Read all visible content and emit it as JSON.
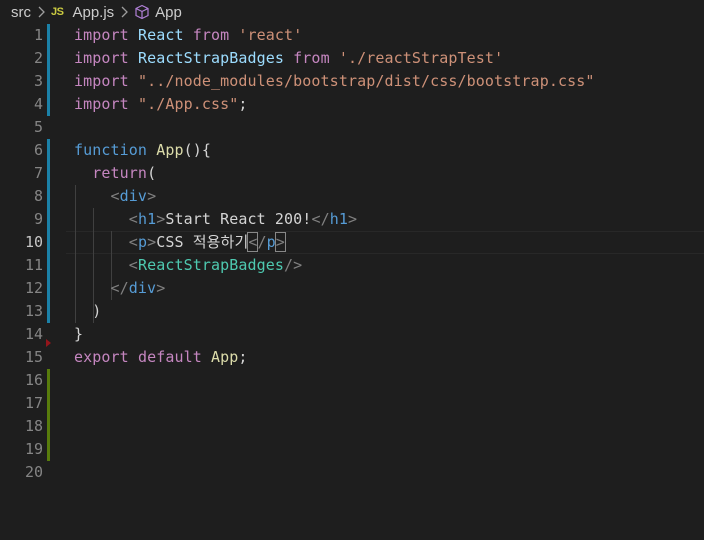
{
  "breadcrumb": {
    "folder": "src",
    "file_badge": "JS",
    "file": "App.js",
    "symbol": "App"
  },
  "active_line": 10,
  "gutter": {
    "modified_lines": [
      1,
      2,
      3,
      4,
      6,
      7,
      8,
      9,
      10,
      11,
      12,
      13
    ],
    "added_lines": [
      16,
      17,
      18,
      19
    ],
    "deleted_after_line": 14
  },
  "lines": [
    {
      "n": "1",
      "tokens": [
        {
          "t": "import",
          "c": "kw2"
        },
        {
          "t": " "
        },
        {
          "t": "React",
          "c": "id"
        },
        {
          "t": " "
        },
        {
          "t": "from",
          "c": "kw2"
        },
        {
          "t": " "
        },
        {
          "t": "'react'",
          "c": "str"
        }
      ]
    },
    {
      "n": "2",
      "tokens": [
        {
          "t": "import",
          "c": "kw2"
        },
        {
          "t": " "
        },
        {
          "t": "ReactStrapBadges",
          "c": "id"
        },
        {
          "t": " "
        },
        {
          "t": "from",
          "c": "kw2"
        },
        {
          "t": " "
        },
        {
          "t": "'./reactStrapTest'",
          "c": "str"
        }
      ]
    },
    {
      "n": "3",
      "tokens": [
        {
          "t": "import",
          "c": "kw2"
        },
        {
          "t": " "
        },
        {
          "t": "\"../node_modules/bootstrap/dist/css/bootstrap.css\"",
          "c": "str"
        }
      ]
    },
    {
      "n": "4",
      "tokens": [
        {
          "t": "import",
          "c": "kw2"
        },
        {
          "t": " "
        },
        {
          "t": "\"./App.css\"",
          "c": "str"
        },
        {
          "t": ";",
          "c": "pun"
        }
      ]
    },
    {
      "n": "5",
      "tokens": []
    },
    {
      "n": "6",
      "tokens": [
        {
          "t": "function",
          "c": "kw"
        },
        {
          "t": " "
        },
        {
          "t": "App",
          "c": "fn"
        },
        {
          "t": "(){",
          "c": "pun"
        }
      ]
    },
    {
      "n": "7",
      "tokens": [
        {
          "t": "  "
        },
        {
          "t": "return",
          "c": "kw2"
        },
        {
          "t": "(",
          "c": "pun"
        }
      ]
    },
    {
      "n": "8",
      "tokens": [
        {
          "t": "    "
        },
        {
          "t": "<",
          "c": "brk"
        },
        {
          "t": "div",
          "c": "tag"
        },
        {
          "t": ">",
          "c": "brk"
        }
      ]
    },
    {
      "n": "9",
      "tokens": [
        {
          "t": "      "
        },
        {
          "t": "<",
          "c": "brk"
        },
        {
          "t": "h1",
          "c": "tag"
        },
        {
          "t": ">",
          "c": "brk"
        },
        {
          "t": "Start React 200!",
          "c": "txt"
        },
        {
          "t": "</",
          "c": "brk"
        },
        {
          "t": "h1",
          "c": "tag"
        },
        {
          "t": ">",
          "c": "brk"
        }
      ]
    },
    {
      "n": "10",
      "tokens": [
        {
          "t": "      "
        },
        {
          "t": "<",
          "c": "brk"
        },
        {
          "t": "p",
          "c": "tag"
        },
        {
          "t": ">",
          "c": "brk"
        },
        {
          "t": "CSS 적용하기",
          "c": "txt"
        },
        {
          "t": "<",
          "c": "brk bm"
        },
        {
          "t": "/",
          "c": "brk"
        },
        {
          "t": "p",
          "c": "tag"
        },
        {
          "t": ">",
          "c": "brk bm"
        }
      ]
    },
    {
      "n": "11",
      "tokens": [
        {
          "t": "      "
        },
        {
          "t": "<",
          "c": "brk"
        },
        {
          "t": "ReactStrapBadges",
          "c": "cmp"
        },
        {
          "t": "/>",
          "c": "brk"
        }
      ]
    },
    {
      "n": "12",
      "tokens": [
        {
          "t": "    "
        },
        {
          "t": "</",
          "c": "brk"
        },
        {
          "t": "div",
          "c": "tag"
        },
        {
          "t": ">",
          "c": "brk"
        }
      ]
    },
    {
      "n": "13",
      "tokens": [
        {
          "t": "  "
        },
        {
          "t": ")",
          "c": "pun"
        }
      ]
    },
    {
      "n": "14",
      "tokens": [
        {
          "t": "}",
          "c": "pun"
        }
      ]
    },
    {
      "n": "15",
      "tokens": [
        {
          "t": "export",
          "c": "kw2"
        },
        {
          "t": " "
        },
        {
          "t": "default",
          "c": "kw2"
        },
        {
          "t": " "
        },
        {
          "t": "App",
          "c": "fn"
        },
        {
          "t": ";",
          "c": "pun"
        }
      ]
    },
    {
      "n": "16",
      "tokens": []
    },
    {
      "n": "17",
      "tokens": []
    },
    {
      "n": "18",
      "tokens": []
    },
    {
      "n": "19",
      "tokens": []
    },
    {
      "n": "20",
      "tokens": []
    }
  ]
}
